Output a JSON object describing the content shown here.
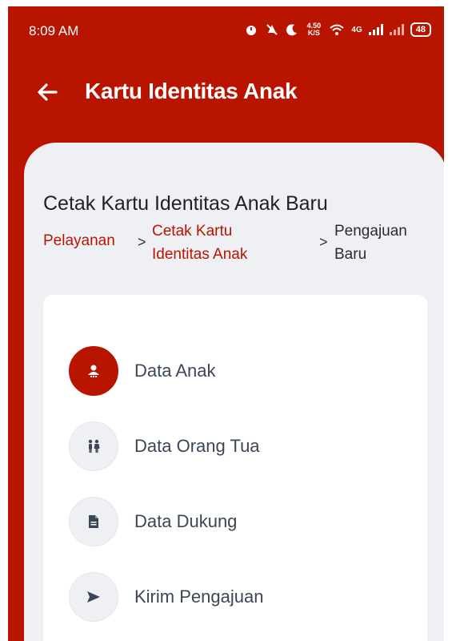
{
  "status_bar": {
    "time": "8:09 AM",
    "net_speed": "4.50 K/S",
    "network": "4G",
    "battery": "48"
  },
  "app_bar": {
    "title": "Kartu Identitas Anak"
  },
  "page": {
    "heading": "Cetak Kartu Identitas Anak Baru",
    "breadcrumb": [
      {
        "label": "Pelayanan"
      },
      {
        "label": "Cetak Kartu Identitas Anak"
      },
      {
        "label": "Pengajuan Baru"
      }
    ],
    "separator": ">"
  },
  "steps": [
    {
      "label": "Data Anak",
      "icon": "child-icon",
      "active": true
    },
    {
      "label": "Data Orang Tua",
      "icon": "parents-icon",
      "active": false
    },
    {
      "label": "Data Dukung",
      "icon": "document-icon",
      "active": false
    },
    {
      "label": "Kirim Pengajuan",
      "icon": "send-icon",
      "active": false
    }
  ],
  "colors": {
    "primary": "#b81400",
    "sheet_bg": "#eef0f4",
    "step_label": "#3b4756"
  }
}
